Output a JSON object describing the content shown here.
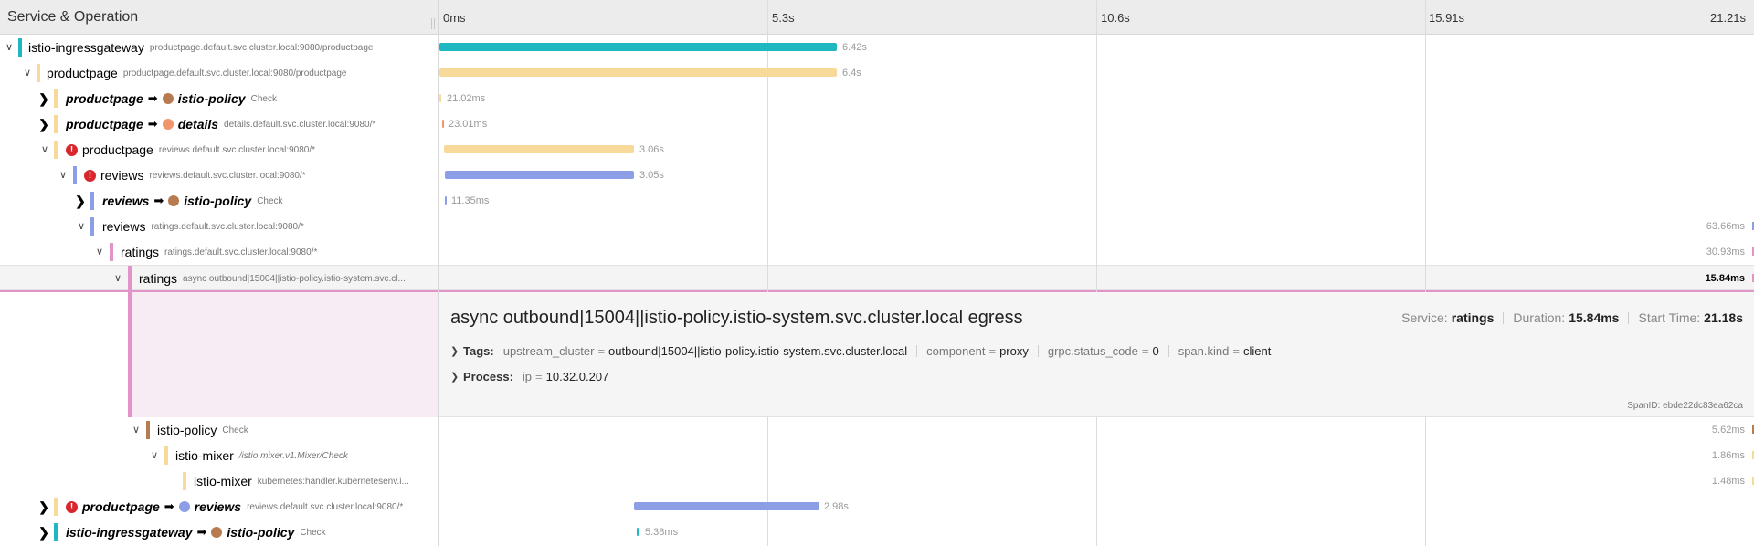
{
  "header": {
    "title": "Service & Operation",
    "ticks": [
      "0ms",
      "5.3s",
      "10.6s",
      "15.91s",
      "21.21s"
    ]
  },
  "colors": {
    "istio-ingressgateway": "#1fb8c1",
    "productpage": "#f7d99a",
    "istio-policy": "#b87b50",
    "details": "#f1966a",
    "reviews": "#8c9ee5",
    "ratings": "#e293c8",
    "istio-mixer": "#f7d99a",
    "error": "#d9262c"
  },
  "rows": [
    {
      "service": "istio-ingressgateway",
      "op": "productpage.default.svc.cluster.local:9080/productpage",
      "duration": "6.42s",
      "caret": "open"
    },
    {
      "service": "productpage",
      "op": "productpage.default.svc.cluster.local:9080/productpage",
      "duration": "6.4s",
      "caret": "open"
    },
    {
      "service": "productpage",
      "target": "istio-policy",
      "op": "Check",
      "duration": "21.02ms",
      "caret": "closed"
    },
    {
      "service": "productpage",
      "target": "details",
      "op": "details.default.svc.cluster.local:9080/*",
      "duration": "23.01ms",
      "caret": "closed"
    },
    {
      "service": "productpage",
      "op": "reviews.default.svc.cluster.local:9080/*",
      "duration": "3.06s",
      "caret": "open",
      "error": true
    },
    {
      "service": "reviews",
      "op": "reviews.default.svc.cluster.local:9080/*",
      "duration": "3.05s",
      "caret": "open",
      "error": true
    },
    {
      "service": "reviews",
      "target": "istio-policy",
      "op": "Check",
      "duration": "11.35ms",
      "caret": "closed"
    },
    {
      "service": "reviews",
      "op": "ratings.default.svc.cluster.local:9080/*",
      "duration": "63.66ms",
      "caret": "open"
    },
    {
      "service": "ratings",
      "op": "ratings.default.svc.cluster.local:9080/*",
      "duration": "30.93ms",
      "caret": "open"
    },
    {
      "service": "ratings",
      "op": "async outbound|15004||istio-policy.istio-system.svc.cl...",
      "duration": "15.84ms",
      "caret": "open",
      "selected": true
    }
  ],
  "detail": {
    "title": "async outbound|15004||istio-policy.istio-system.svc.cluster.local egress",
    "service_label": "Service:",
    "service": "ratings",
    "duration_label": "Duration:",
    "duration": "15.84ms",
    "start_label": "Start Time:",
    "start": "21.18s",
    "tags_label": "Tags:",
    "tags": [
      {
        "k": "upstream_cluster",
        "v": "outbound|15004||istio-policy.istio-system.svc.cluster.local"
      },
      {
        "k": "component",
        "v": "proxy"
      },
      {
        "k": "grpc.status_code",
        "v": "0"
      },
      {
        "k": "span.kind",
        "v": "client"
      }
    ],
    "process_label": "Process:",
    "process": [
      {
        "k": "ip",
        "v": "10.32.0.207"
      }
    ],
    "spanid_label": "SpanID:",
    "spanid": "ebde22dc83ea62ca"
  },
  "rows_after": [
    {
      "service": "istio-policy",
      "op": "Check",
      "duration": "5.62ms",
      "caret": "open"
    },
    {
      "service": "istio-mixer",
      "op": "/istio.mixer.v1.Mixer/Check",
      "duration": "1.86ms",
      "caret": "open"
    },
    {
      "service": "istio-mixer",
      "op": "kubernetes:handler.kubernetesenv.i...",
      "duration": "1.48ms",
      "caret": "none"
    },
    {
      "service": "productpage",
      "target": "reviews",
      "op": "reviews.default.svc.cluster.local:9080/*",
      "duration": "2.98s",
      "caret": "closed",
      "error": true
    },
    {
      "service": "istio-ingressgateway",
      "target": "istio-policy",
      "op": "Check",
      "duration": "5.38ms",
      "caret": "closed"
    }
  ]
}
